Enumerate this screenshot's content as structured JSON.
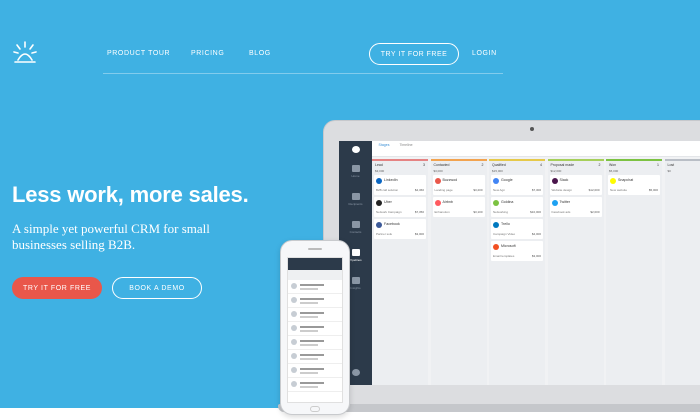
{
  "nav": {
    "product_tour": "PRODUCT TOUR",
    "pricing": "PRICING",
    "blog": "BLOG",
    "try_free": "TRY IT FOR FREE",
    "login": "LOGIN"
  },
  "hero": {
    "headline": "Less work, more sales.",
    "subheadline": "A simple yet powerful CRM for small businesses selling B2B.",
    "cta_primary": "TRY IT FOR FREE",
    "cta_secondary": "BOOK A DEMO"
  },
  "app": {
    "tabs": [
      "Stages",
      "Timeline"
    ],
    "sidebar": [
      "Home",
      "Recipients",
      "Contacts",
      "Pipelines",
      "Insights"
    ],
    "columns": [
      {
        "name": "Lead",
        "count": "3",
        "amount": "$3,000",
        "color": "#e58383",
        "cards": [
          {
            "name": "LinkedIn",
            "desc": "B2B call solution",
            "value": "$4,360",
            "color": "#0a66c2"
          },
          {
            "name": "Uber",
            "desc": "Network Campaign",
            "value": "$7,350",
            "color": "#222222"
          },
          {
            "name": "Facebook",
            "desc": "Partner solu",
            "value": "$3,000",
            "color": "#3b5998"
          }
        ]
      },
      {
        "name": "Contacted",
        "count": "2",
        "amount": "$3,000",
        "color": "#f2a34f",
        "cards": [
          {
            "name": "Buzzwod",
            "desc": "Landing page",
            "value": "$3,200",
            "color": "#e9574a"
          },
          {
            "name": "Airbnb",
            "desc": "Enhanution",
            "value": "$3,100",
            "color": "#ff5a5f"
          }
        ]
      },
      {
        "name": "Qualified",
        "count": "4",
        "amount": "$15,000",
        "color": "#e6c94a",
        "cards": [
          {
            "name": "Google",
            "desc": "New Agn",
            "value": "$7,300",
            "color": "#4285f4"
          },
          {
            "name": "Goldina",
            "desc": "Networking",
            "value": "$10,000",
            "color": "#7cc242"
          },
          {
            "name": "Trello",
            "desc": "Campaign Video",
            "value": "$4,000",
            "color": "#0079bf"
          },
          {
            "name": "Microsoft",
            "desc": "Email templates",
            "value": "$3,000",
            "color": "#f25022"
          }
        ]
      },
      {
        "name": "Proposal made",
        "count": "2",
        "amount": "$12,000",
        "color": "#a6cf5a",
        "cards": [
          {
            "name": "Slack",
            "desc": "Website design",
            "value": "$12,000",
            "color": "#4a154b"
          },
          {
            "name": "Twitter",
            "desc": "Facebook ads",
            "value": "$2,000",
            "color": "#1da1f2"
          }
        ]
      },
      {
        "name": "Won",
        "count": "1",
        "amount": "$5,000",
        "color": "#7cc242",
        "cards": [
          {
            "name": "Snapchat",
            "desc": "New website",
            "value": "$5,000",
            "color": "#fffc00"
          }
        ]
      },
      {
        "name": "Lost",
        "count": "",
        "amount": "$0",
        "color": "#b9bec6",
        "cards": []
      }
    ]
  }
}
